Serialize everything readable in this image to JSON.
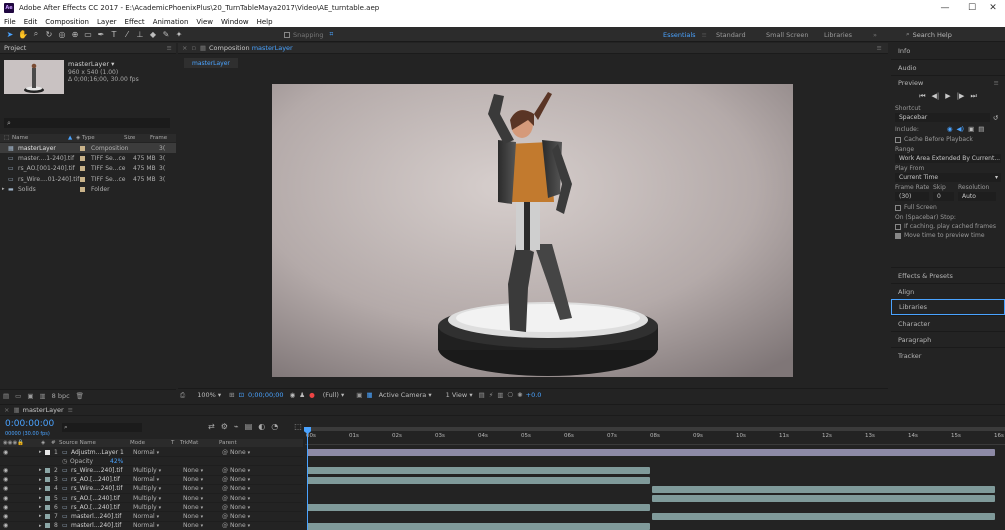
{
  "window": {
    "title": "Adobe After Effects CC 2017 - E:\\AcademicPhoenixPlus\\20_TurnTableMaya2017\\Video\\AE_turntable.aep",
    "app_badge": "Ae"
  },
  "menu": [
    "File",
    "Edit",
    "Composition",
    "Layer",
    "Effect",
    "Animation",
    "View",
    "Window",
    "Help"
  ],
  "toolbar": {
    "snapping_label": "Snapping"
  },
  "workspaces": {
    "active": "Essentials",
    "items": [
      "Standard",
      "Small Screen",
      "Libraries"
    ],
    "search_placeholder": "Search Help"
  },
  "project": {
    "tab": "Project",
    "selected_name": "masterLayer",
    "selected_info1": "960 x 540 (1.00)",
    "selected_info2": "Δ 0;00;16;00, 30.00 fps",
    "columns": {
      "name": "Name",
      "type": "Type",
      "size": "Size",
      "frame": "Frame"
    },
    "items": [
      {
        "name": "masterLayer",
        "type": "Composition",
        "size": "",
        "frame": "3(",
        "color": "#c9b38a",
        "icon": "composition-icon"
      },
      {
        "name": "master....1-240].tif",
        "type": "TIFF Se...ce",
        "size": "475 MB",
        "frame": "3(",
        "color": "#c9b38a",
        "icon": "footage-icon"
      },
      {
        "name": "rs_AO.[001-240].tif",
        "type": "TIFF Se...ce",
        "size": "475 MB",
        "frame": "3(",
        "color": "#c9b38a",
        "icon": "footage-icon"
      },
      {
        "name": "rs_Wire....01-240].tif",
        "type": "TIFF Se...ce",
        "size": "475 MB",
        "frame": "3(",
        "color": "#c9b38a",
        "icon": "footage-icon"
      },
      {
        "name": "Solids",
        "type": "Folder",
        "size": "",
        "frame": "",
        "color": "#c9b38a",
        "icon": "folder-icon"
      }
    ],
    "bpc": "8 bpc"
  },
  "composition": {
    "tab_prefix": "Composition",
    "tab_name": "masterLayer",
    "subtab": "masterLayer",
    "zoom": "100%",
    "timecode": "0;00;00;00",
    "resolution": "(Full)",
    "camera": "Active Camera",
    "views": "1 View",
    "exposure": "+0.0"
  },
  "right_panel": {
    "info": "Info",
    "audio": "Audio",
    "preview": "Preview",
    "shortcut_label": "Shortcut",
    "shortcut_value": "Spacebar",
    "include_label": "Include:",
    "cache_label": "Cache Before Playback",
    "range_label": "Range",
    "range_value": "Work Area Extended By Current...",
    "playfrom_label": "Play From",
    "playfrom_value": "Current Time",
    "framerate_label": "Frame Rate",
    "skip_label": "Skip",
    "resolution_label": "Resolution",
    "framerate_value": "(30)",
    "skip_value": "0",
    "resolution_value": "Auto",
    "fullscreen_label": "Full Screen",
    "stop_label": "On (Spacebar) Stop:",
    "stop_opt1": "If caching, play cached frames",
    "stop_opt2": "Move time to preview time",
    "panels": [
      "Effects & Presets",
      "Align",
      "Libraries",
      "Character",
      "Paragraph",
      "Tracker"
    ]
  },
  "timeline": {
    "tab": "masterLayer",
    "timecode": "0:00:00:00",
    "sub_timecode": "00000 (30.00 fps)",
    "columns": {
      "source": "Source Name",
      "mode": "Mode",
      "t": "T",
      "trkmat": "TrkMat",
      "parent": "Parent"
    },
    "ruler": [
      "00s",
      "01s",
      "02s",
      "03s",
      "04s",
      "05s",
      "06s",
      "07s",
      "08s",
      "09s",
      "10s",
      "11s",
      "12s",
      "13s",
      "14s",
      "15s",
      "16s"
    ],
    "layers": [
      {
        "num": "1",
        "name": "Adjustm...Layer 1",
        "mode": "Normal",
        "trkmat": "",
        "parent": "None",
        "color": "#e6e6e6",
        "bar_start": 0.0,
        "bar_end": 1.0
      },
      {
        "num": "",
        "name": "Opacity",
        "mode": "",
        "trkmat": "",
        "parent": "",
        "value": "42%",
        "color": "",
        "bar_start": null,
        "bar_end": null
      },
      {
        "num": "2",
        "name": "rs_Wire....240].tif",
        "mode": "Multiply",
        "trkmat": "None",
        "parent": "None",
        "color": "#8ba6a6",
        "bar_start": 0.0,
        "bar_end": 0.5
      },
      {
        "num": "3",
        "name": "rs_AO.[...240].tif",
        "mode": "Normal",
        "trkmat": "None",
        "parent": "None",
        "color": "#8ba6a6",
        "bar_start": 0.0,
        "bar_end": 0.5
      },
      {
        "num": "4",
        "name": "rs_Wire....240].tif",
        "mode": "Multiply",
        "trkmat": "None",
        "parent": "None",
        "color": "#8ba6a6",
        "bar_start": 0.5,
        "bar_end": 1.0
      },
      {
        "num": "5",
        "name": "rs_AO.[...240].tif",
        "mode": "Multiply",
        "trkmat": "None",
        "parent": "None",
        "color": "#8ba6a6",
        "bar_start": 0.5,
        "bar_end": 1.0
      },
      {
        "num": "6",
        "name": "rs_AO.[...240].tif",
        "mode": "Multiply",
        "trkmat": "None",
        "parent": "None",
        "color": "#8ba6a6",
        "bar_start": 0.0,
        "bar_end": 0.5
      },
      {
        "num": "7",
        "name": "masterl...240].tif",
        "mode": "Normal",
        "trkmat": "None",
        "parent": "None",
        "color": "#8ba6a6",
        "bar_start": 0.5,
        "bar_end": 1.0
      },
      {
        "num": "8",
        "name": "masterl...240].tif",
        "mode": "Normal",
        "trkmat": "None",
        "parent": "None",
        "color": "#8ba6a6",
        "bar_start": 0.0,
        "bar_end": 0.5
      }
    ]
  }
}
